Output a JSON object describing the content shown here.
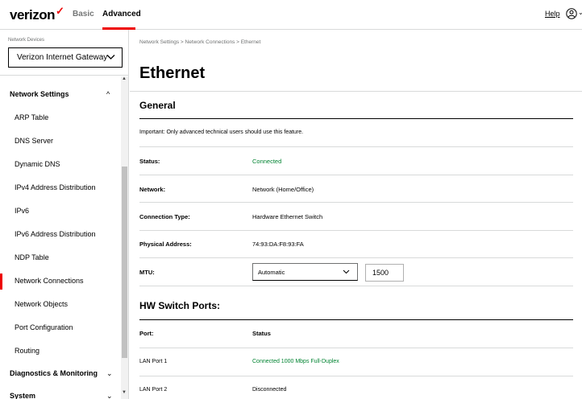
{
  "header": {
    "logo": "verizon",
    "tabs": [
      {
        "label": "Basic"
      },
      {
        "label": "Advanced"
      }
    ],
    "help_label": "Help",
    "accent_color": "#ee0000"
  },
  "sidebar": {
    "devices_label": "Network Devices",
    "selected_device": "Verizon Internet Gateway",
    "items": [
      {
        "label": "Network Settings",
        "section": true
      },
      {
        "label": "ARP Table"
      },
      {
        "label": "DNS Server"
      },
      {
        "label": "Dynamic DNS"
      },
      {
        "label": "IPv4 Address Distribution"
      },
      {
        "label": "IPv6"
      },
      {
        "label": "IPv6 Address Distribution"
      },
      {
        "label": "NDP Table"
      },
      {
        "label": "Network Connections",
        "active": true
      },
      {
        "label": "Network Objects"
      },
      {
        "label": "Port Configuration"
      },
      {
        "label": "Routing"
      },
      {
        "label": "Diagnostics & Monitoring",
        "section": true
      },
      {
        "label": "System",
        "section": true
      }
    ]
  },
  "main": {
    "breadcrumb": "Network Settings  >  Network Connections  >  Ethernet",
    "title": "Ethernet",
    "general": {
      "title": "General",
      "note": "Important: Only advanced technical users should use this feature.",
      "status_label": "Status:",
      "status_value": "Connected",
      "network_label": "Network:",
      "network_value": "Network (Home/Office)",
      "conn_type_label": "Connection Type:",
      "conn_type_value": "Hardware Ethernet Switch",
      "phys_addr_label": "Physical Address:",
      "phys_addr_value": "74:93:DA:F8:93:FA",
      "mtu_label": "MTU:",
      "mtu_mode": "Automatic",
      "mtu_value": "1500"
    },
    "hw_ports": {
      "title": "HW Switch Ports:",
      "col_port": "Port:",
      "col_status": "Status",
      "rows": [
        {
          "port": "LAN Port 1",
          "status": "Connected 1000 Mbps Full-Duplex"
        },
        {
          "port": "LAN Port 2",
          "status": "Disconnected"
        }
      ]
    },
    "status_green": "#008331"
  }
}
